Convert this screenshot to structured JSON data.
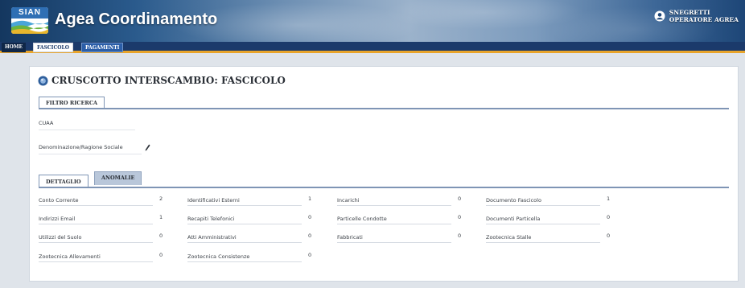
{
  "header": {
    "logo_text": "SIAN",
    "app_title": "Agea Coordinamento",
    "user_name": "SNEGRETTI",
    "user_role": "OPERATORE AGREA"
  },
  "nav": {
    "tabs": [
      {
        "label": "HOME"
      },
      {
        "label": "FASCICOLO",
        "active": true
      },
      {
        "label": "PAGAMENTI"
      }
    ]
  },
  "panel": {
    "title": "CRUSCOTTO INTERSCAMBIO: FASCICOLO",
    "filter_tab": "FILTRO RICERCA",
    "fields": [
      {
        "label": "CUAA",
        "value": ""
      },
      {
        "label": "Denominazione/Ragione Sociale",
        "value": ""
      }
    ],
    "detail_tabs": [
      {
        "label": "DETTAGLIO",
        "active": true
      },
      {
        "label": "ANOMALIE",
        "active": false
      }
    ],
    "details": [
      [
        {
          "label": "Conto Corrente",
          "value": "2"
        },
        {
          "label": "Identificativi Esterni",
          "value": "1"
        },
        {
          "label": "Incarichi",
          "value": "0"
        },
        {
          "label": "Documento Fascicolo",
          "value": "1"
        }
      ],
      [
        {
          "label": "Indirizzi Email",
          "value": "1"
        },
        {
          "label": "Recapiti Telefonici",
          "value": "0"
        },
        {
          "label": "Particelle Condotte",
          "value": "0"
        },
        {
          "label": "Documenti Particella",
          "value": "0"
        }
      ],
      [
        {
          "label": "Utilizzi del Suolo",
          "value": "0"
        },
        {
          "label": "Atti Amministrativi",
          "value": "0"
        },
        {
          "label": "Fabbricati",
          "value": "0"
        },
        {
          "label": "Zootecnica Stalle",
          "value": "0"
        }
      ],
      [
        {
          "label": "Zootecnica Allevamenti",
          "value": "0"
        },
        {
          "label": "Zootecnica Consistenze",
          "value": "0"
        }
      ]
    ]
  },
  "colors": {
    "nav_bar": "#1b3a6b",
    "nav_accent": "#e8a42b",
    "tab_border": "#7f95b5",
    "anomalie_tab_bg": "#b9c7da"
  },
  "icons": {
    "logo": "sian-logo-icon",
    "user": "user-icon",
    "title": "blue-circle-icon",
    "pencil": "pencil-icon"
  }
}
